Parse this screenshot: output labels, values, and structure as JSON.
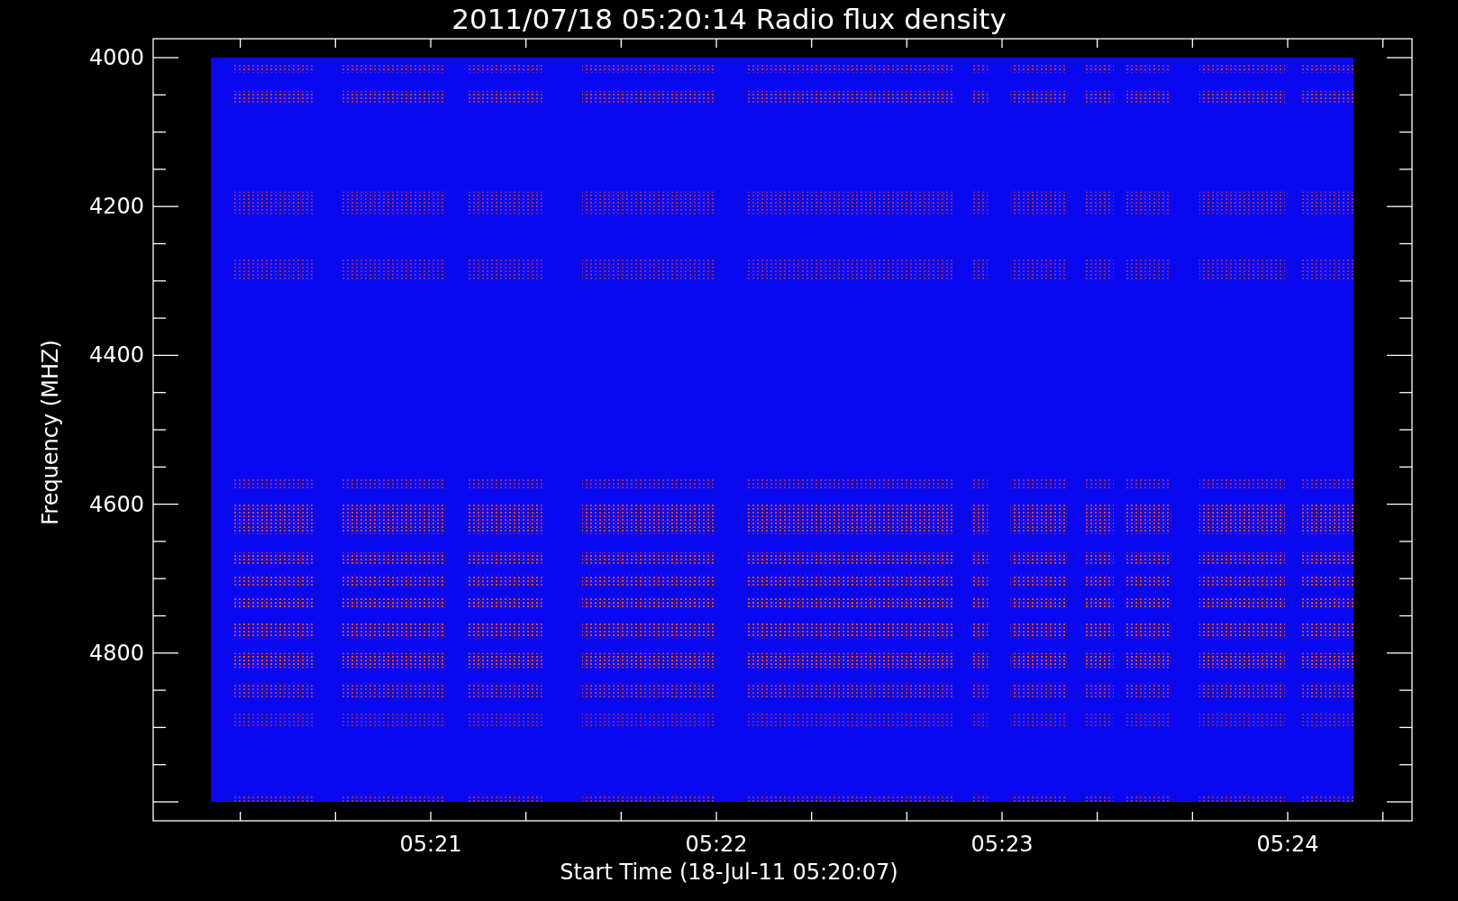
{
  "title": "2011/07/18 05:20:14 Radio flux density",
  "y_axis": {
    "label": "Frequency (MHZ)",
    "ticks": [
      "4000",
      "4200",
      "4400",
      "4600",
      "4800"
    ]
  },
  "x_axis": {
    "label": "Start Time (18-Jul-11 05:20:07)",
    "ticks": [
      "05:21",
      "05:22",
      "05:23",
      "05:24"
    ]
  }
}
